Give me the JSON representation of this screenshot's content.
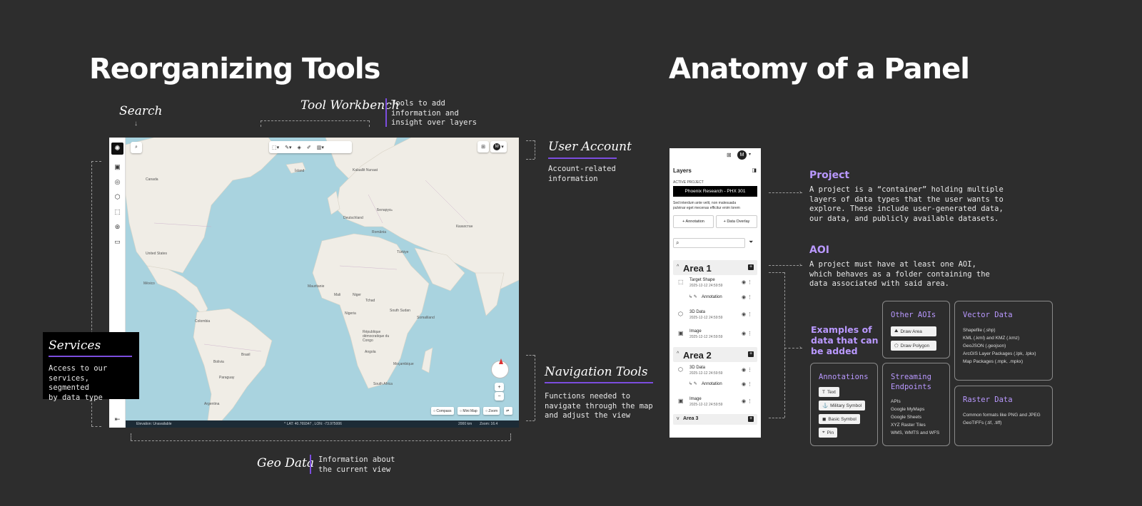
{
  "left_section": {
    "title": "Reorganizing Tools",
    "search_label": "Search",
    "search_arrow": "↓",
    "workbench_label": "Tool Workbench",
    "workbench_desc": [
      "Tools to add",
      "information and",
      "insight over layers"
    ],
    "user_account_label": "User Account",
    "user_account_desc": [
      "Account-related",
      "information"
    ],
    "services_label": "Services",
    "services_desc": [
      "Access to our",
      "services, segmented",
      "by data type"
    ],
    "navigation_label": "Navigation Tools",
    "navigation_desc": [
      "Functions needed to",
      "navigate through the map",
      "and adjust the view"
    ],
    "geo_label": "Geo Data",
    "geo_desc": [
      "Information about",
      "the current view"
    ]
  },
  "map_ui": {
    "avatar": "M",
    "labels": {
      "canada": "Canada",
      "iceland": "Ísland",
      "greenland": "Kalaallit Nunaat",
      "deutschland": "Deutschland",
      "belarus": "Беларусь",
      "romania": "România",
      "kazakhstan": "Казахстан",
      "turkiye": "Türkiye",
      "usa": "United States",
      "mexico": "México",
      "colombia": "Colombia",
      "brasil": "Brasil",
      "bolivia": "Bolivia",
      "paraguay": "Paraguay",
      "argentina": "Argentina",
      "mauritanie": "Mauritanie",
      "mali": "Mali",
      "niger": "Niger",
      "tchad": "Tchad",
      "nigeria": "Nigeria",
      "south_sudan": "South Sudan",
      "rdc": "République démocratique du Congo",
      "angola": "Angola",
      "somaliland": "Somaliland",
      "mocambique": "Moçambique",
      "south_africa": "South Africa"
    },
    "status": {
      "elevation": "Elevation: Unavailable",
      "coords": "^ LAT: 40.769347 , LON: -73.975006",
      "scale": "2000 km",
      "zoom": "Zoom: 16.4"
    },
    "bottom_controls": [
      "Compass",
      "Mini Map",
      "Zoom"
    ],
    "zoom_in": "+",
    "zoom_out": "−"
  },
  "right_section": {
    "title": "Anatomy of a Panel",
    "project_heading": "Project",
    "project_desc": [
      "A project is a “container” holding multiple",
      "layers of data types that the user wants to",
      "explore. These include user-generated data,",
      "our data, and publicly available datasets."
    ],
    "aoi_heading": "AOI",
    "aoi_desc": [
      "A project must have at least one AOI,",
      "which behaves as a folder containing the",
      "data associated with said area."
    ],
    "examples_heading": [
      "Examples of",
      "data that can",
      "be added"
    ],
    "annotations": {
      "heading": "Annotations",
      "chips": [
        "Text",
        "Military Symbol",
        "Basic Symbol",
        "Pin"
      ]
    },
    "other_aois": {
      "heading": "Other AOIs",
      "chips": [
        "Draw Area",
        "Draw Polygon"
      ]
    },
    "streaming": {
      "heading": [
        "Streaming",
        "Endpoints"
      ],
      "items": [
        "APIs",
        "Google MyMaps",
        "Google Sheets",
        "XYZ Raster Tiles",
        "WMS, WMTS and WFS"
      ]
    },
    "vector": {
      "heading": "Vector Data",
      "items": [
        "Shapefile (.shp)",
        "KML (.kml) and KMZ (.kmz)",
        "GeoJSON (.geojson)",
        "ArcGIS Layer Packages (.lpk, .lpkx)",
        "Map Packages (.mpk, .mpkx)"
      ]
    },
    "raster": {
      "heading": "Raster Data",
      "items": [
        "Common formats like PNG and JPEG",
        "GeoTIFFs (.tif, .tiff)"
      ]
    }
  },
  "panel": {
    "avatar": "M",
    "title": "Layers",
    "active_project_label": "ACTIVE PROJECT",
    "active_project": "Phoenix Research - PHX 301",
    "description": [
      "Sed interdum ante velit, non malesuada",
      "pulvinar eget mecenas efficitur enim lorem"
    ],
    "annotation_button": "+ Annotation",
    "data_overlay_button": "+ Data Overlay",
    "search_placeholder": "",
    "area1": {
      "name": "Area 1",
      "items": [
        {
          "title": "Target Shape",
          "date": "2025-12-12 24:59:59"
        },
        {
          "title": "Annotation",
          "date": ""
        },
        {
          "title": "3D Data",
          "date": "2025-12-12 24:59:59"
        },
        {
          "title": "Image",
          "date": "2025-12-12 24:59:59"
        }
      ]
    },
    "area2": {
      "name": "Area 2",
      "items": [
        {
          "title": "3D Data",
          "date": "2025-12-12 24:59:59"
        },
        {
          "title": "Annotation",
          "date": ""
        },
        {
          "title": "Image",
          "date": "2025-12-12 24:59:59"
        }
      ]
    },
    "area3": {
      "name": "Area 3"
    }
  },
  "colors": {
    "background": "#2d2d2d",
    "accent": "#7c4ddf",
    "heading_purple": "#b998ff",
    "ocean": "#a9d3df",
    "land": "#f0ede6"
  }
}
